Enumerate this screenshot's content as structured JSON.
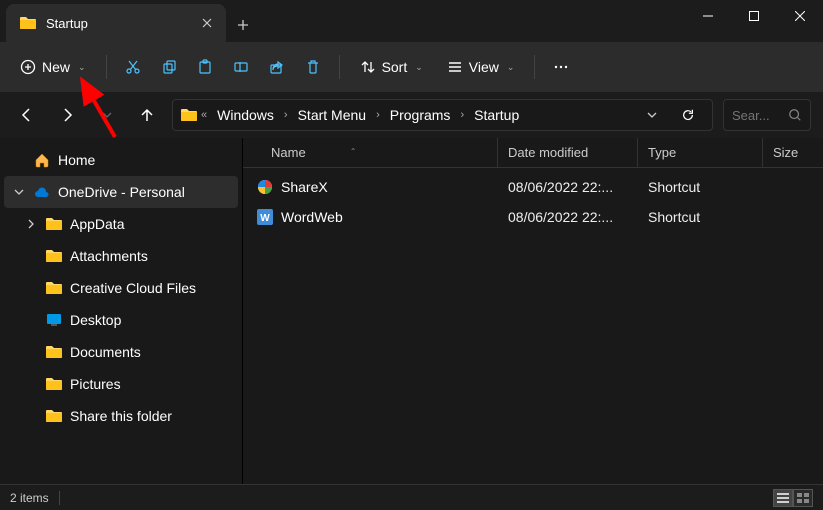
{
  "tab": {
    "title": "Startup"
  },
  "toolbar": {
    "new_label": "New",
    "sort_label": "Sort",
    "view_label": "View"
  },
  "breadcrumb": {
    "items": [
      "Windows",
      "Start Menu",
      "Programs",
      "Startup"
    ]
  },
  "search": {
    "placeholder": "Sear..."
  },
  "sidebar": {
    "home": "Home",
    "onedrive": "OneDrive - Personal",
    "items": [
      "AppData",
      "Attachments",
      "Creative Cloud Files",
      "Desktop",
      "Documents",
      "Pictures",
      "Share this folder"
    ]
  },
  "columns": {
    "name": "Name",
    "date": "Date modified",
    "type": "Type",
    "size": "Size"
  },
  "files": [
    {
      "name": "ShareX",
      "date": "08/06/2022 22:...",
      "type": "Shortcut"
    },
    {
      "name": "WordWeb",
      "date": "08/06/2022 22:...",
      "type": "Shortcut"
    }
  ],
  "status": {
    "count": "2 items"
  }
}
